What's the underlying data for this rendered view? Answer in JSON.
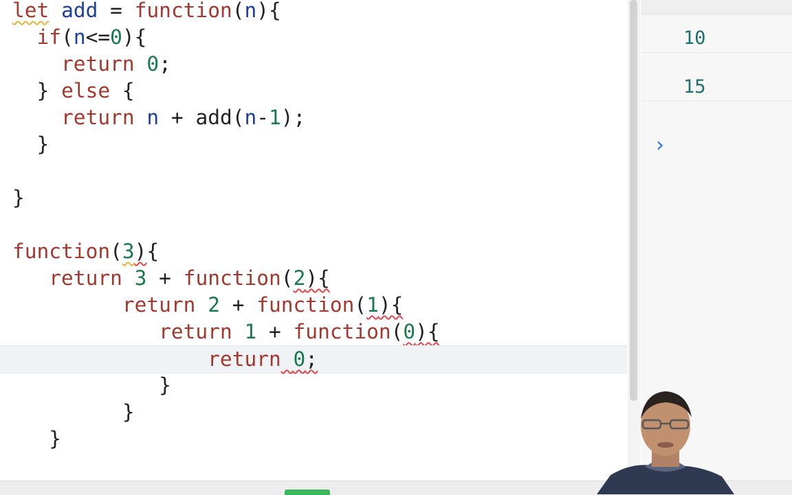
{
  "editor": {
    "lines": [
      [
        {
          "t": "let",
          "c": "kw",
          "sq": "y"
        },
        {
          "t": " "
        },
        {
          "t": "add",
          "c": "var"
        },
        {
          "t": " = "
        },
        {
          "t": "function",
          "c": "kw"
        },
        {
          "t": "("
        },
        {
          "t": "n",
          "c": "var"
        },
        {
          "t": "){"
        }
      ],
      [
        {
          "t": "  "
        },
        {
          "t": "if",
          "c": "kw"
        },
        {
          "t": "("
        },
        {
          "t": "n",
          "c": "var"
        },
        {
          "t": "<="
        },
        {
          "t": "0",
          "c": "num"
        },
        {
          "t": "){"
        }
      ],
      [
        {
          "t": "    "
        },
        {
          "t": "return",
          "c": "kw"
        },
        {
          "t": " "
        },
        {
          "t": "0",
          "c": "num"
        },
        {
          "t": ";"
        }
      ],
      [
        {
          "t": "  "
        },
        {
          "t": "}"
        },
        {
          "t": " "
        },
        {
          "t": "else",
          "c": "kw"
        },
        {
          "t": " {"
        }
      ],
      [
        {
          "t": "    "
        },
        {
          "t": "return",
          "c": "kw"
        },
        {
          "t": " "
        },
        {
          "t": "n",
          "c": "var"
        },
        {
          "t": " + add("
        },
        {
          "t": "n",
          "c": "var"
        },
        {
          "t": "-"
        },
        {
          "t": "1",
          "c": "num"
        },
        {
          "t": ");"
        }
      ],
      [
        {
          "t": "  "
        },
        {
          "t": "}"
        }
      ],
      [
        {
          "t": ""
        }
      ],
      [
        {
          "t": "}"
        }
      ],
      [
        {
          "t": ""
        }
      ],
      [
        {
          "t": "function",
          "c": "kw"
        },
        {
          "t": "("
        },
        {
          "t": "3",
          "c": "num",
          "sq": "y"
        },
        {
          "t": ")",
          "sq": "r"
        },
        {
          "t": "{"
        }
      ],
      [
        {
          "t": "   "
        },
        {
          "t": "return",
          "c": "kw"
        },
        {
          "t": " "
        },
        {
          "t": "3",
          "c": "num"
        },
        {
          "t": " + "
        },
        {
          "t": "function",
          "c": "kw"
        },
        {
          "t": "("
        },
        {
          "t": "2",
          "c": "num",
          "sq": "r"
        },
        {
          "t": "){",
          "sq": "r"
        }
      ],
      [
        {
          "t": "         "
        },
        {
          "t": "return",
          "c": "kw"
        },
        {
          "t": " "
        },
        {
          "t": "2",
          "c": "num"
        },
        {
          "t": " + "
        },
        {
          "t": "function",
          "c": "kw"
        },
        {
          "t": "("
        },
        {
          "t": "1",
          "c": "num",
          "sq": "r"
        },
        {
          "t": "){",
          "sq": "r"
        }
      ],
      [
        {
          "t": "            "
        },
        {
          "t": "return",
          "c": "kw"
        },
        {
          "t": " "
        },
        {
          "t": "1",
          "c": "num"
        },
        {
          "t": " + "
        },
        {
          "t": "function",
          "c": "kw"
        },
        {
          "t": "("
        },
        {
          "t": "0",
          "c": "num",
          "sq": "r"
        },
        {
          "t": "){",
          "sq": "r"
        }
      ],
      [
        {
          "t": "                "
        },
        {
          "t": "return",
          "c": "kw"
        },
        {
          "t": " ",
          "sq": "r"
        },
        {
          "t": "0",
          "c": "num",
          "sq": "r"
        },
        {
          "t": ";",
          "sq": "r"
        }
      ],
      [
        {
          "t": "            "
        },
        {
          "t": "}"
        }
      ],
      [
        {
          "t": "         "
        },
        {
          "t": "}"
        }
      ],
      [
        {
          "t": "   "
        },
        {
          "t": "}"
        }
      ]
    ],
    "active_line_index": 13
  },
  "console": {
    "outputs": [
      "10",
      "15"
    ],
    "prompt_icon": "chevron-right-icon",
    "prompt_color": "#2a73e8"
  },
  "colors": {
    "keyword": "#a5382e",
    "identifier": "#1d3fa0",
    "number": "#197a4e",
    "output": "#1f6f6c",
    "run_tab": "#3cb65a"
  },
  "webcam": {
    "label_icon": "presenter-avatar-icon"
  }
}
